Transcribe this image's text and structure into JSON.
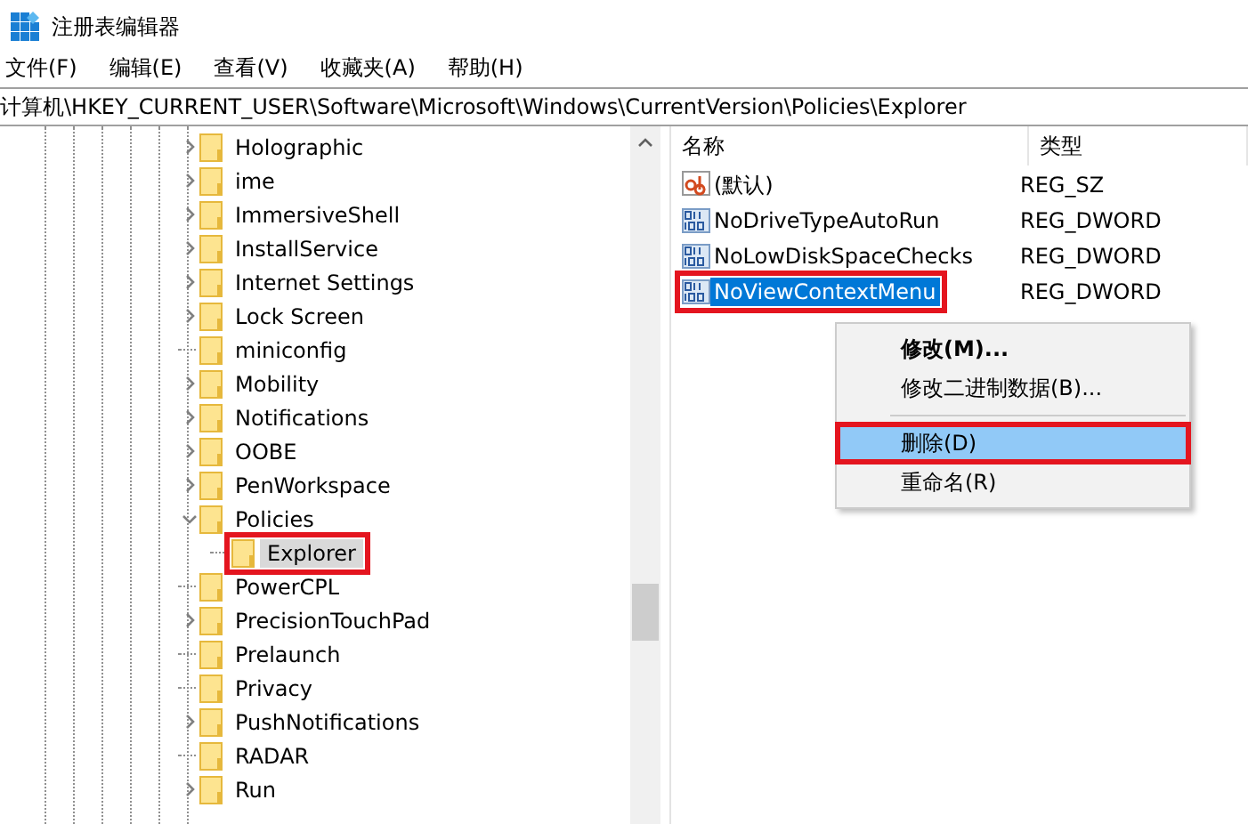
{
  "window": {
    "title": "注册表编辑器"
  },
  "menu": [
    "文件(F)",
    "编辑(E)",
    "查看(V)",
    "收藏夹(A)",
    "帮助(H)"
  ],
  "address": "计算机\\HKEY_CURRENT_USER\\Software\\Microsoft\\Windows\\CurrentVersion\\Policies\\Explorer",
  "tree": [
    {
      "label": "Holographic",
      "kind": "branch",
      "expanded": false,
      "selected": false,
      "highlighted": false
    },
    {
      "label": "ime",
      "kind": "branch",
      "expanded": false,
      "selected": false,
      "highlighted": false
    },
    {
      "label": "ImmersiveShell",
      "kind": "branch",
      "expanded": false,
      "selected": false,
      "highlighted": false
    },
    {
      "label": "InstallService",
      "kind": "branch",
      "expanded": false,
      "selected": false,
      "highlighted": false
    },
    {
      "label": "Internet Settings",
      "kind": "branch",
      "expanded": false,
      "selected": false,
      "highlighted": false
    },
    {
      "label": "Lock Screen",
      "kind": "branch",
      "expanded": false,
      "selected": false,
      "highlighted": false
    },
    {
      "label": "miniconfig",
      "kind": "leaf",
      "selected": false,
      "highlighted": false
    },
    {
      "label": "Mobility",
      "kind": "branch",
      "expanded": false,
      "selected": false,
      "highlighted": false
    },
    {
      "label": "Notifications",
      "kind": "branch",
      "expanded": false,
      "selected": false,
      "highlighted": false
    },
    {
      "label": "OOBE",
      "kind": "branch",
      "expanded": false,
      "selected": false,
      "highlighted": false
    },
    {
      "label": "PenWorkspace",
      "kind": "branch",
      "expanded": false,
      "selected": false,
      "highlighted": false
    },
    {
      "label": "Policies",
      "kind": "branch",
      "expanded": true,
      "selected": false,
      "highlighted": false,
      "children": [
        {
          "label": "Explorer",
          "kind": "leaf",
          "selected": true,
          "highlighted": true
        }
      ]
    },
    {
      "label": "PowerCPL",
      "kind": "leaf",
      "selected": false,
      "highlighted": false
    },
    {
      "label": "PrecisionTouchPad",
      "kind": "branch",
      "expanded": false,
      "selected": false,
      "highlighted": false
    },
    {
      "label": "Prelaunch",
      "kind": "leaf",
      "selected": false,
      "highlighted": false
    },
    {
      "label": "Privacy",
      "kind": "leaf",
      "selected": false,
      "highlighted": false
    },
    {
      "label": "PushNotifications",
      "kind": "branch",
      "expanded": false,
      "selected": false,
      "highlighted": false
    },
    {
      "label": "RADAR",
      "kind": "leaf",
      "selected": false,
      "highlighted": false
    },
    {
      "label": "Run",
      "kind": "branch",
      "expanded": false,
      "selected": false,
      "highlighted": false
    }
  ],
  "columns": [
    "名称",
    "类型"
  ],
  "values": [
    {
      "name": "(默认)",
      "type": "REG_SZ",
      "kind": "string",
      "selected": false,
      "highlighted": false
    },
    {
      "name": "NoDriveTypeAutoRun",
      "type": "REG_DWORD",
      "kind": "binary",
      "selected": false,
      "highlighted": false
    },
    {
      "name": "NoLowDiskSpaceChecks",
      "type": "REG_DWORD",
      "kind": "binary",
      "selected": false,
      "highlighted": false
    },
    {
      "name": "NoViewContextMenu",
      "type": "REG_DWORD",
      "kind": "binary",
      "selected": true,
      "highlighted": true
    }
  ],
  "context_menu": [
    {
      "kind": "item",
      "label": "修改(M)...",
      "default": true,
      "selected": false,
      "highlighted": false
    },
    {
      "kind": "item",
      "label": "修改二进制数据(B)...",
      "default": false,
      "selected": false,
      "highlighted": false
    },
    {
      "kind": "separator"
    },
    {
      "kind": "item",
      "label": "删除(D)",
      "default": false,
      "selected": true,
      "highlighted": true
    },
    {
      "kind": "item",
      "label": "重命名(R)",
      "default": false,
      "selected": false,
      "highlighted": false
    }
  ]
}
